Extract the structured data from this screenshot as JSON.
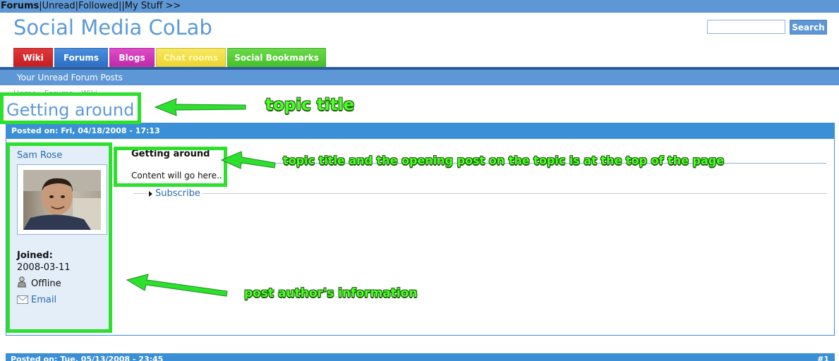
{
  "topbar": {
    "first": "Forums",
    "rest": "|Unread|Followed||My Stuff >>"
  },
  "site": {
    "title": "Social Media CoLab"
  },
  "search": {
    "button": "Search",
    "value": ""
  },
  "tabs": [
    {
      "label": "Wiki",
      "color": "#d22b2e"
    },
    {
      "label": "Forums",
      "color": "#3a7fd2"
    },
    {
      "label": "Blogs",
      "color": "#d03ab8"
    },
    {
      "label": "Chat rooms",
      "color": "#f0dc3e"
    },
    {
      "label": "Social Bookmarks",
      "color": "#55cc35"
    }
  ],
  "subnav": {
    "label": "Your Unread Forum Posts"
  },
  "breadcrumb": "Home › Forums › Wiki",
  "topic": {
    "title": "Getting around"
  },
  "post": {
    "posted": "Posted on: Fri, 04/18/2008 - 17:13",
    "author": {
      "name": "Sam Rose",
      "joined_label": "Joined:",
      "joined_date": "2008-03-11",
      "status": "Offline",
      "email": "Email"
    },
    "title": "Getting around",
    "body": "Content will go here..",
    "subscribe": "Subscribe"
  },
  "post2": {
    "posted": "Posted on: Tue, 05/13/2008 - 23:45",
    "number": "#1"
  },
  "annotations": {
    "topic_title": "topic title",
    "opening_post": "topic title and the opening post on the topic is at the top of the page",
    "author_info": "post author's information",
    "color": "#2ee02e"
  }
}
